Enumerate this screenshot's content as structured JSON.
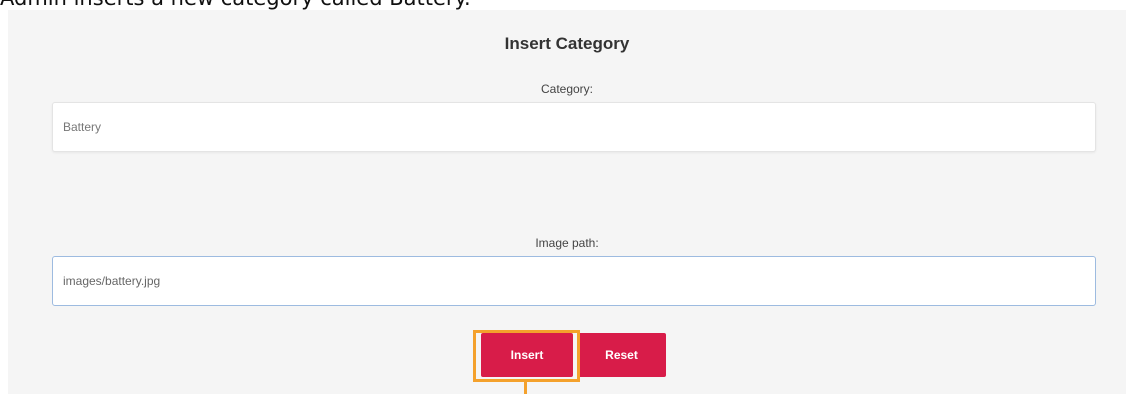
{
  "caption": "Admin inserts a new category called Battery.",
  "form": {
    "title": "Insert Category",
    "category": {
      "label": "Category:",
      "value": "Battery"
    },
    "image_path": {
      "label": "Image path:",
      "value": "images/battery.jpg"
    },
    "buttons": {
      "insert_label": "Insert",
      "reset_label": "Reset"
    }
  },
  "colors": {
    "button": "#d81c49",
    "highlight": "#f4a12c",
    "panel": "#f5f5f5"
  }
}
